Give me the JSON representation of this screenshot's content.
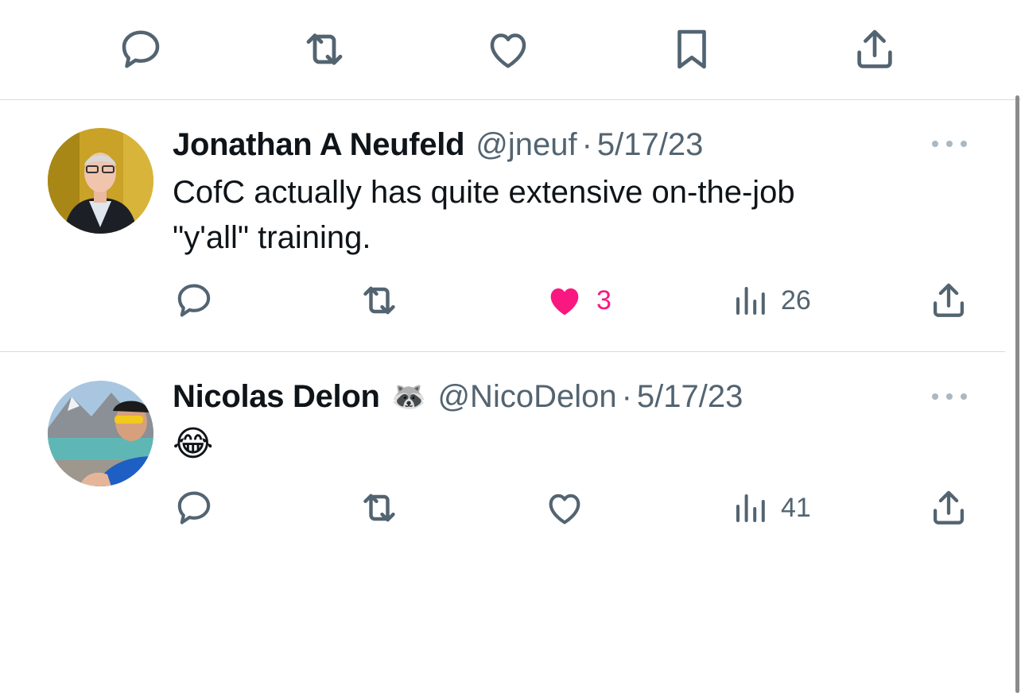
{
  "focused_tweet_actions": {
    "icons": [
      "reply-icon",
      "retweet-icon",
      "like-icon",
      "bookmark-icon",
      "share-icon"
    ]
  },
  "replies": [
    {
      "name": "Jonathan A Neufeld",
      "handle": "@jneuf",
      "separator": "·",
      "date": "5/17/23",
      "text": "CofC actually has quite extensive on-the-job\n\"y'all\" training.",
      "likes": "3",
      "liked": true,
      "views": "26"
    },
    {
      "name": "Nicolas Delon",
      "badge_emoji": "🦝",
      "handle": "@NicoDelon",
      "separator": "·",
      "date": "5/17/23",
      "text": "😂",
      "likes": "",
      "liked": false,
      "views": "41"
    }
  ],
  "colors": {
    "icon_gray": "#536471",
    "like_pink": "#f91880",
    "divider": "#d6dbdf"
  }
}
